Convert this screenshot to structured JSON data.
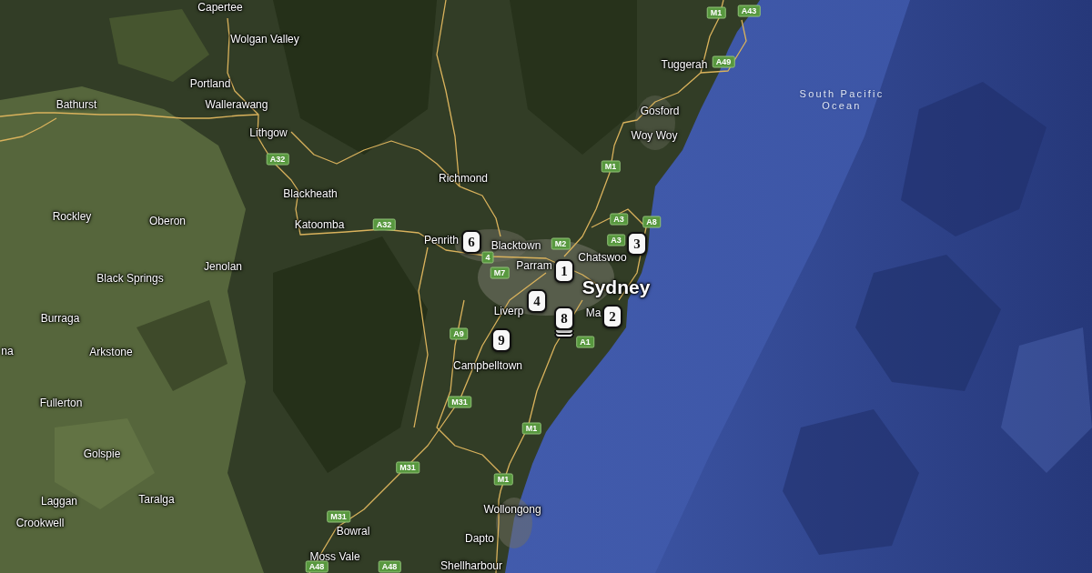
{
  "map": {
    "places": [
      {
        "name": "Capertee",
        "kind": "town"
      },
      {
        "name": "Wolgan Valley",
        "kind": "town"
      },
      {
        "name": "Tuggerah",
        "kind": "town"
      },
      {
        "name": "Portland",
        "kind": "town"
      },
      {
        "name": "Bathurst",
        "kind": "town"
      },
      {
        "name": "Wallerawang",
        "kind": "town"
      },
      {
        "name": "Gosford",
        "kind": "town"
      },
      {
        "name": "South Pacific Ocean",
        "kind": "ocean"
      },
      {
        "name": "Lithgow",
        "kind": "town"
      },
      {
        "name": "Woy Woy",
        "kind": "town"
      },
      {
        "name": "Richmond",
        "kind": "town"
      },
      {
        "name": "Blackheath",
        "kind": "town"
      },
      {
        "name": "Rockley",
        "kind": "town"
      },
      {
        "name": "Oberon",
        "kind": "town"
      },
      {
        "name": "Katoomba",
        "kind": "town"
      },
      {
        "name": "Penrith",
        "kind": "town"
      },
      {
        "name": "Blacktown",
        "kind": "town"
      },
      {
        "name": "Chatswoo",
        "kind": "town"
      },
      {
        "name": "Parram",
        "kind": "town"
      },
      {
        "name": "Jenolan",
        "kind": "town"
      },
      {
        "name": "Black Springs",
        "kind": "town"
      },
      {
        "name": "Sydney",
        "kind": "city"
      },
      {
        "name": "Liverp",
        "kind": "town"
      },
      {
        "name": "Ma",
        "kind": "town"
      },
      {
        "name": "Burraga",
        "kind": "town"
      },
      {
        "name": "na",
        "kind": "town"
      },
      {
        "name": "Arkstone",
        "kind": "town"
      },
      {
        "name": "Campbelltown",
        "kind": "town"
      },
      {
        "name": "Fullerton",
        "kind": "town"
      },
      {
        "name": "Golspie",
        "kind": "town"
      },
      {
        "name": "Taralga",
        "kind": "town"
      },
      {
        "name": "Laggan",
        "kind": "town"
      },
      {
        "name": "Wollongong",
        "kind": "town"
      },
      {
        "name": "Crookwell",
        "kind": "town"
      },
      {
        "name": "Bowral",
        "kind": "town"
      },
      {
        "name": "Dapto",
        "kind": "town"
      },
      {
        "name": "Moss Vale",
        "kind": "town"
      },
      {
        "name": "Shellharbour",
        "kind": "town"
      }
    ],
    "route_shields": [
      "M1",
      "A43",
      "A49",
      "A32",
      "M1",
      "A3",
      "A32",
      "A8",
      "A3",
      "M2",
      "4",
      "M7",
      "A9",
      "A1",
      "M31",
      "M1",
      "M31",
      "M1",
      "M31",
      "A48",
      "A48"
    ],
    "markers": [
      {
        "label": "6",
        "stacked": false
      },
      {
        "label": "3",
        "stacked": false
      },
      {
        "label": "1",
        "stacked": false
      },
      {
        "label": "4",
        "stacked": false
      },
      {
        "label": "2",
        "stacked": false
      },
      {
        "label": "8",
        "stacked": true
      },
      {
        "label": "9",
        "stacked": false
      }
    ]
  }
}
